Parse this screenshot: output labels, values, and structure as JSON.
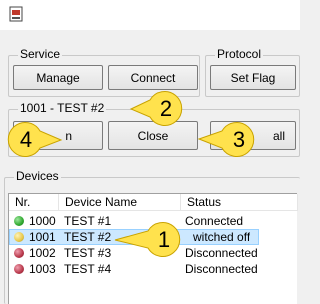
{
  "service": {
    "label": "Service",
    "manage_label": "Manage",
    "connect_label": "Connect"
  },
  "protocol": {
    "label": "Protocol",
    "set_flag_label": "Set Flag"
  },
  "device_group": {
    "label": "1001 - TEST #2",
    "open_label_partial": "n",
    "close_label": "Close",
    "all_label_partial": "all"
  },
  "devices": {
    "label": "Devices",
    "columns": [
      "Nr.",
      "Device Name",
      "Status"
    ],
    "rows": [
      {
        "nr": "1000",
        "name": "TEST #1",
        "status": "Connected",
        "indicator": "green",
        "color": "#2fa82f",
        "selected": false
      },
      {
        "nr": "1001",
        "name": "TEST #2",
        "status": "Switched off",
        "status_visible": "witched off",
        "indicator": "yellow",
        "color": "#e8c84a",
        "selected": true
      },
      {
        "nr": "1002",
        "name": "TEST #3",
        "status": "Disconnected",
        "indicator": "red",
        "color": "#b8374a",
        "selected": false
      },
      {
        "nr": "1003",
        "name": "TEST #4",
        "status": "Disconnected",
        "indicator": "red",
        "color": "#b8374a",
        "selected": false
      }
    ]
  },
  "callouts": [
    "1",
    "2",
    "3",
    "4"
  ],
  "colors": {
    "callout_fill": "#ffe24d",
    "callout_stroke": "#c9a300",
    "selection": "#cce8ff"
  }
}
